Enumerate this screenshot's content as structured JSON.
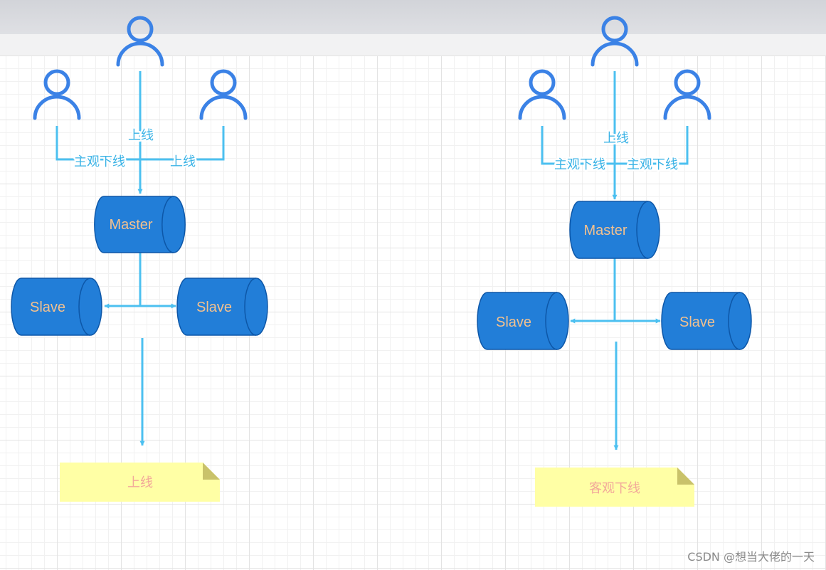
{
  "left": {
    "master": "Master",
    "slave_left": "Slave",
    "slave_right": "Slave",
    "label_top": "上线",
    "label_left": "主观下线",
    "label_right": "上线",
    "note": "上线"
  },
  "right": {
    "master": "Master",
    "slave_left": "Slave",
    "slave_right": "Slave",
    "label_top": "上线",
    "label_left": "主观下线",
    "label_right": "主观下线",
    "note": "客观下线"
  },
  "watermark": "CSDN @想当大佬的一天",
  "colors": {
    "user_icon": "#3b82e6",
    "arrow": "#4cc0f0",
    "db_fill": "#227ed8",
    "db_stroke": "#0d57a8",
    "db_text": "#f3c18f",
    "note_fill": "#ffffa5",
    "note_text": "#f2a99a"
  }
}
